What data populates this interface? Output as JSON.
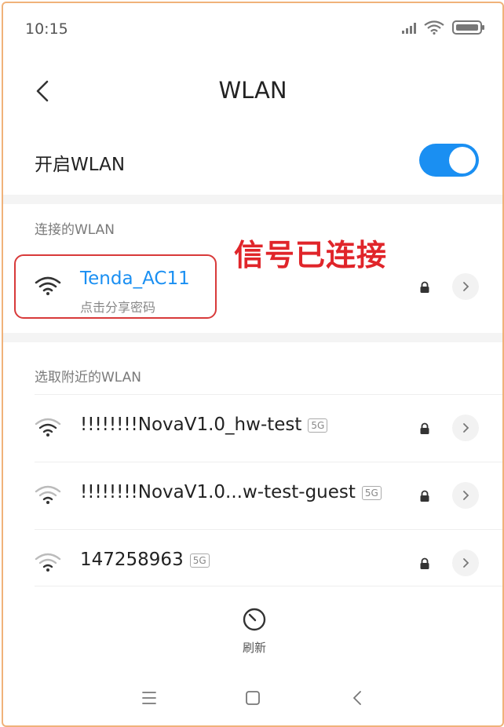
{
  "status_bar": {
    "time": "10:15",
    "icons": [
      "signal-icon",
      "wifi-icon",
      "battery-icon"
    ]
  },
  "header": {
    "back_icon": "back-arrow-icon",
    "title": "WLAN"
  },
  "wlan_toggle": {
    "label": "开启WLAN",
    "state": "on",
    "color": "#1a8ff2"
  },
  "connected_section": {
    "header": "连接的WLAN",
    "network": {
      "ssid": "Tenda_AC11",
      "subtitle": "点击分享密码",
      "secured": true,
      "ssid_color": "#1a8ff2"
    },
    "annotation": "信号已连接",
    "annotation_color": "#e0252a"
  },
  "nearby_section": {
    "header": "选取附近的WLAN",
    "networks": [
      {
        "ssid": "!!!!!!!!NovaV1.0_hw-test",
        "band": "5G",
        "secured": true
      },
      {
        "ssid": "!!!!!!!!NovaV1.0...w-test-guest",
        "band": "5G",
        "secured": true
      },
      {
        "ssid": "147258963",
        "band": "5G",
        "secured": true
      }
    ]
  },
  "refresh": {
    "icon": "refresh-icon",
    "label": "刷新"
  },
  "nav_bar": {
    "buttons": [
      "menu-icon",
      "home-icon",
      "back-icon"
    ]
  }
}
